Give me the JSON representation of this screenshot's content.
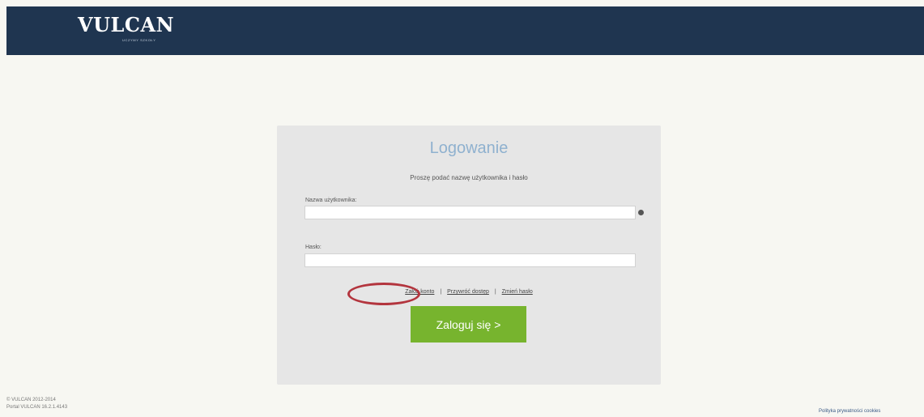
{
  "header": {
    "logo_text": "VULCAN",
    "logo_subtext": "UCZYMY SZKOŁY"
  },
  "login": {
    "title": "Logowanie",
    "subtitle": "Proszę podać nazwę użytkownika i hasło",
    "username_label": "Nazwa użytkownika:",
    "username_value": "",
    "password_label": "Hasło:",
    "password_value": "",
    "links": {
      "create_account": "Załóż konto",
      "check_access": "Przywróć dostęp",
      "separator": "|",
      "change_password": "Zmień hasło"
    },
    "submit_label": "Zaloguj się >"
  },
  "footer": {
    "copyright": "© VULCAN 2012-2014",
    "version": "Portal VULCAN 16.2.1.4143",
    "privacy_link": "Polityka prywatności cookies"
  },
  "colors": {
    "header_bg": "#1f3550",
    "panel_bg": "#e6e6e6",
    "title": "#8fb1cf",
    "button_bg": "#77b42e",
    "annotation_ring": "#b3353e"
  }
}
